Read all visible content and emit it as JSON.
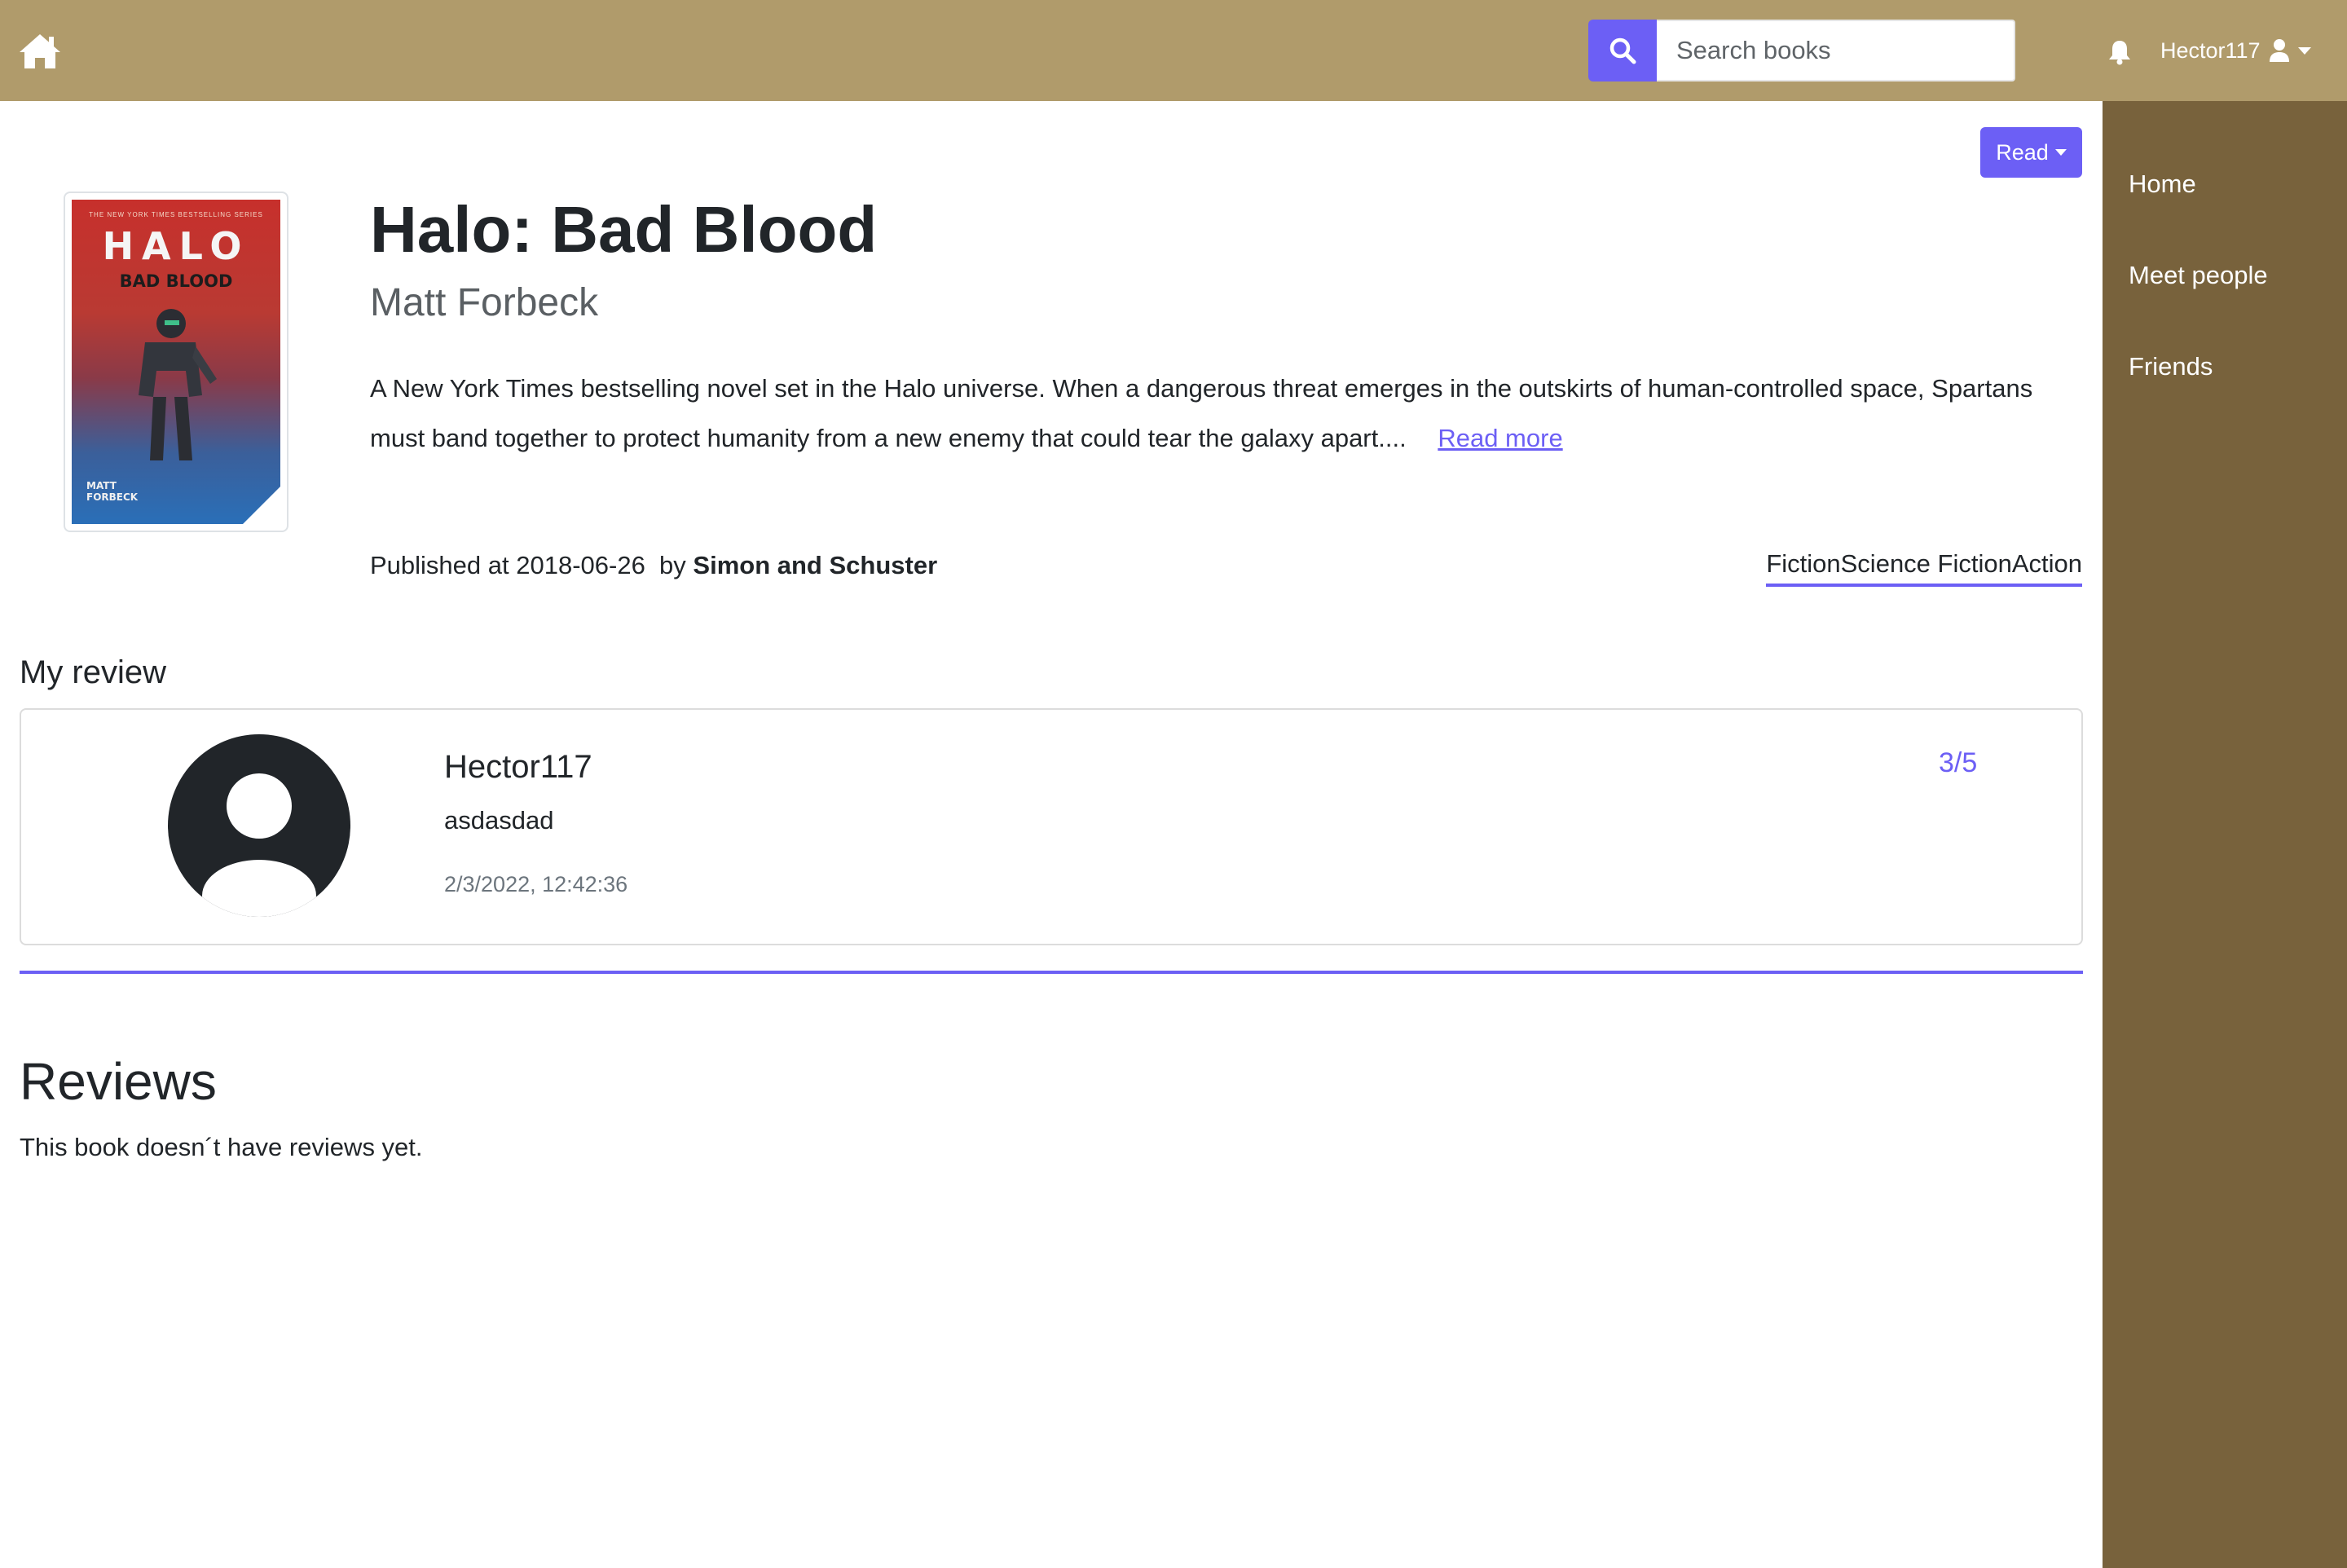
{
  "header": {
    "search": {
      "placeholder": "Search books",
      "value": ""
    },
    "username": "Hector117"
  },
  "sidebar": {
    "items": [
      {
        "label": "Home"
      },
      {
        "label": "Meet people"
      },
      {
        "label": "Friends"
      }
    ]
  },
  "book": {
    "status_button": "Read",
    "title": "Halo: Bad Blood",
    "author": "Matt Forbeck",
    "description": "A New York Times bestselling novel set in the Halo universe. When a dangerous threat emerges in the outskirts of human-controlled space, Spartans must band together to protect humanity from a new enemy that could tear the galaxy apart....",
    "read_more": "Read more",
    "published_prefix": "Published at 2018-06-26",
    "published_by": "by",
    "publisher": "Simon and Schuster",
    "genres": "FictionScience FictionAction",
    "cover": {
      "series_line": "THE NEW YORK TIMES BESTSELLING SERIES",
      "title": "HALO",
      "subtitle": "BAD BLOOD",
      "author_line1": "MATT",
      "author_line2": "FORBECK"
    }
  },
  "my_review": {
    "heading": "My review",
    "user": "Hector117",
    "text": "asdasdad",
    "date": "2/3/2022, 12:42:36",
    "rating": "3/5"
  },
  "reviews": {
    "heading": "Reviews",
    "empty_text": "This book doesn´t have reviews yet."
  },
  "colors": {
    "topbar": "#b09b6b",
    "sidebar": "#78623c",
    "accent": "#6c5ff5"
  },
  "icons": {
    "home": "home-icon",
    "search": "search-icon",
    "bell": "bell-icon",
    "user": "user-icon",
    "avatar": "avatar-icon"
  }
}
